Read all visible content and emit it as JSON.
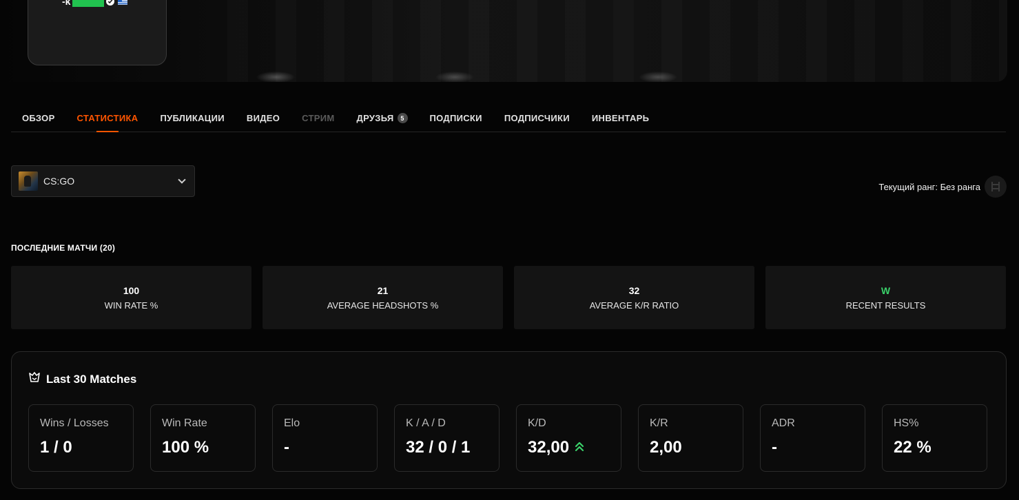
{
  "profile": {
    "nickname_prefix": "-k"
  },
  "tabs": [
    {
      "label": "ОБЗОР"
    },
    {
      "label": "СТАТИСТИКА"
    },
    {
      "label": "ПУБЛИКАЦИИ"
    },
    {
      "label": "ВИДЕО"
    },
    {
      "label": "СТРИМ"
    },
    {
      "label": "ДРУЗЬЯ",
      "badge": "5"
    },
    {
      "label": "ПОДПИСКИ"
    },
    {
      "label": "ПОДПИСЧИКИ"
    },
    {
      "label": "ИНВЕНТАРЬ"
    }
  ],
  "game_select": {
    "selected": "CS:GO"
  },
  "rank": {
    "text": "Текущий ранг: Без ранга"
  },
  "recent_matches": {
    "title": "ПОСЛЕДНИЕ МАТЧИ (20)",
    "cards": [
      {
        "value": "100",
        "label": "WIN RATE %"
      },
      {
        "value": "21",
        "label": "AVERAGE HEADSHOTS %"
      },
      {
        "value": "32",
        "label": "AVERAGE K/R RATIO"
      },
      {
        "value": "W",
        "label": "RECENT RESULTS"
      }
    ]
  },
  "last30": {
    "title": "Last 30 Matches",
    "stats": [
      {
        "label": "Wins / Losses",
        "value": "1 / 0"
      },
      {
        "label": "Win Rate",
        "value": "100 %"
      },
      {
        "label": "Elo",
        "value": "-"
      },
      {
        "label": "K / A / D",
        "value": "32 / 0 / 1"
      },
      {
        "label": "K/D",
        "value": "32,00"
      },
      {
        "label": "K/R",
        "value": "2,00"
      },
      {
        "label": "ADR",
        "value": "-"
      },
      {
        "label": "HS%",
        "value": "22 %"
      }
    ]
  },
  "colors": {
    "accent": "#ff5500",
    "positive": "#3ad16a",
    "background": "#050505"
  }
}
